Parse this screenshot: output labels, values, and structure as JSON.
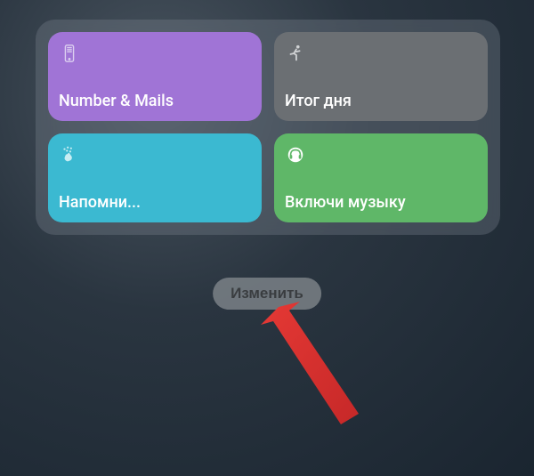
{
  "shortcuts": [
    {
      "label": "Number & Mails",
      "color": "purple",
      "icon": "phone"
    },
    {
      "label": "Итог дня",
      "color": "gray",
      "icon": "running"
    },
    {
      "label": "Напомни...",
      "color": "cyan",
      "icon": "tap"
    },
    {
      "label": "Включи музыку",
      "color": "green",
      "icon": "headphones"
    }
  ],
  "editButton": {
    "label": "Изменить"
  }
}
